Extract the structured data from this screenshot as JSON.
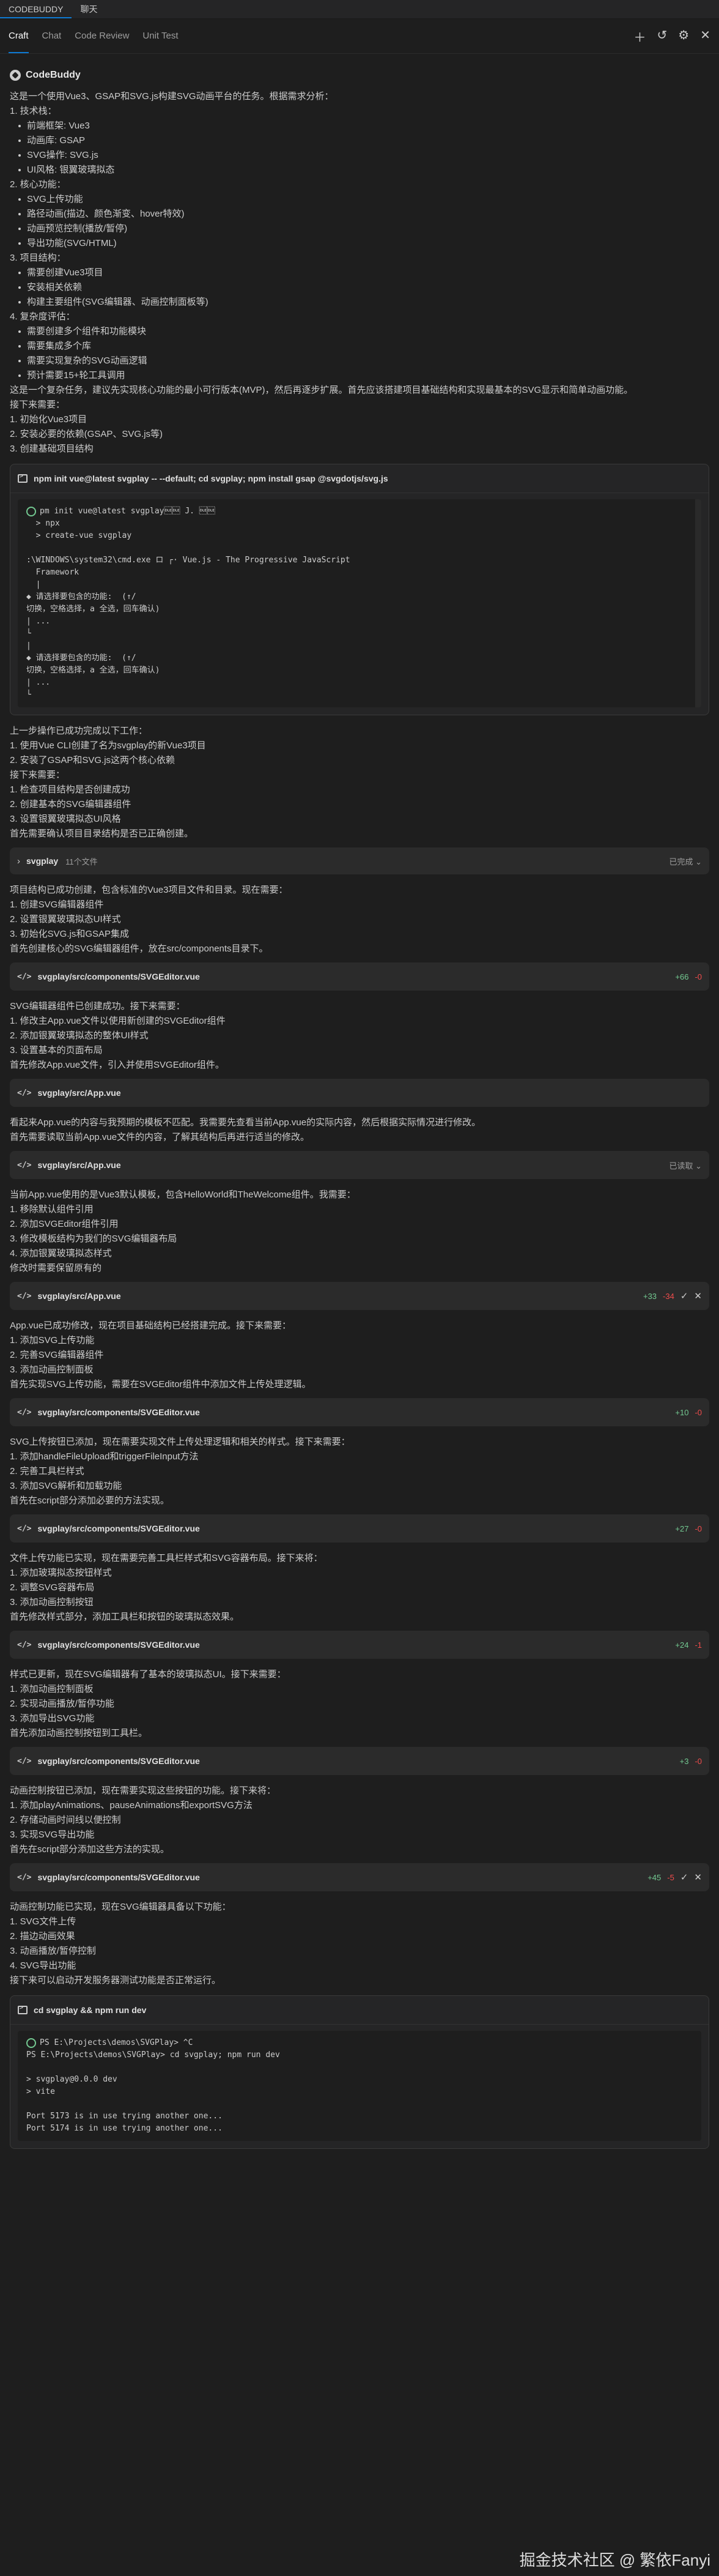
{
  "titlebar": {
    "tabs": [
      "CODEBUDDY",
      "聊天"
    ]
  },
  "tabs": [
    "Craft",
    "Chat",
    "Code Review",
    "Unit Test"
  ],
  "brand": "CodeBuddy",
  "sections": [
    {
      "kind": "text",
      "lines": [
        {
          "t": "这是一个使用Vue3、GSAP和SVG.js构建SVG动画平台的任务。根据需求分析：",
          "s": "p"
        },
        {
          "t": "1. 技术栈：",
          "s": "p"
        },
        {
          "t": "前端框架: Vue3",
          "s": "b"
        },
        {
          "t": "动画库: GSAP",
          "s": "b"
        },
        {
          "t": "SVG操作: SVG.js",
          "s": "b"
        },
        {
          "t": "UI风格: 银翼玻璃拟态",
          "s": "b"
        },
        {
          "t": "2. 核心功能：",
          "s": "p"
        },
        {
          "t": "SVG上传功能",
          "s": "b"
        },
        {
          "t": "路径动画(描边、颜色渐变、hover特效)",
          "s": "b"
        },
        {
          "t": "动画预览控制(播放/暂停)",
          "s": "b"
        },
        {
          "t": "导出功能(SVG/HTML)",
          "s": "b"
        },
        {
          "t": "3. 项目结构：",
          "s": "p"
        },
        {
          "t": "需要创建Vue3项目",
          "s": "b"
        },
        {
          "t": "安装相关依赖",
          "s": "b"
        },
        {
          "t": "构建主要组件(SVG编辑器、动画控制面板等)",
          "s": "b"
        },
        {
          "t": "4. 复杂度评估：",
          "s": "p"
        },
        {
          "t": "需要创建多个组件和功能模块",
          "s": "b"
        },
        {
          "t": "需要集成多个库",
          "s": "b"
        },
        {
          "t": "需要实现复杂的SVG动画逻辑",
          "s": "b"
        },
        {
          "t": "预计需要15+轮工具调用",
          "s": "b"
        },
        {
          "t": "这是一个复杂任务，建议先实现核心功能的最小可行版本(MVP)，然后再逐步扩展。首先应该搭建项目基础结构和实现最基本的SVG显示和简单动画功能。",
          "s": "p"
        },
        {
          "t": "接下来需要：",
          "s": "p"
        },
        {
          "t": "1. 初始化Vue3项目",
          "s": "p"
        },
        {
          "t": "2. 安装必要的依赖(GSAP、SVG.js等)",
          "s": "p"
        },
        {
          "t": "3. 创建基础项目结构",
          "s": "p"
        }
      ]
    },
    {
      "kind": "term",
      "title": "npm init vue@latest svgplay -- --default; cd svgplay; npm install gsap @svgdotjs/svg.js",
      "body": "pm init vue@latest svgplay\u0010\u0010 J. \u0010\u0010\n  > npx\n  > create-vue svgplay\n\n:\\WINDOWS\\system32\\cmd.exe ロ ┌· Vue.js - The Progressive JavaScript\n  Framework\n  |\n◆ 请选择要包含的功能:  (↑/\n切换，空格选择，a 全选，回车确认)\n| ...\n└\n|\n◆ 请选择要包含的功能:  (↑/\n切换，空格选择，a 全选，回车确认)\n| ...\n└",
      "scroll": true
    },
    {
      "kind": "text",
      "lines": [
        {
          "t": "上一步操作已成功完成以下工作：",
          "s": "p"
        },
        {
          "t": "1. 使用Vue CLI创建了名为svgplay的新Vue3项目",
          "s": "p"
        },
        {
          "t": "2. 安装了GSAP和SVG.js这两个核心依赖",
          "s": "p"
        },
        {
          "t": "接下来需要：",
          "s": "p"
        },
        {
          "t": "1. 检查项目结构是否创建成功",
          "s": "p"
        },
        {
          "t": "2. 创建基本的SVG编辑器组件",
          "s": "p"
        },
        {
          "t": "3. 设置银翼玻璃拟态UI风格",
          "s": "p"
        },
        {
          "t": "首先需要确认项目目录结构是否已正确创建。",
          "s": "p"
        }
      ]
    },
    {
      "kind": "folder",
      "name": "svgplay",
      "count": "11个文件",
      "status": "已完成 ⌄"
    },
    {
      "kind": "text",
      "lines": [
        {
          "t": "项目结构已成功创建，包含标准的Vue3项目文件和目录。现在需要：",
          "s": "p"
        },
        {
          "t": "1. 创建SVG编辑器组件",
          "s": "p"
        },
        {
          "t": "2. 设置银翼玻璃拟态UI样式",
          "s": "p"
        },
        {
          "t": "3. 初始化SVG.js和GSAP集成",
          "s": "p"
        },
        {
          "t": "首先创建核心的SVG编辑器组件，放在src/components目录下。",
          "s": "p"
        }
      ]
    },
    {
      "kind": "file",
      "path": "svgplay/src/components/SVGEditor.vue",
      "plus": "+66",
      "minus": "-0",
      "ok": false
    },
    {
      "kind": "text",
      "lines": [
        {
          "t": "SVG编辑器组件已创建成功。接下来需要：",
          "s": "p"
        },
        {
          "t": "1. 修改主App.vue文件以使用新创建的SVGEditor组件",
          "s": "p"
        },
        {
          "t": "2. 添加银翼玻璃拟态的整体UI样式",
          "s": "p"
        },
        {
          "t": "3. 设置基本的页面布局",
          "s": "p"
        },
        {
          "t": "首先修改App.vue文件，引入并使用SVGEditor组件。",
          "s": "p"
        }
      ]
    },
    {
      "kind": "file",
      "path": "svgplay/src/App.vue",
      "plus": "",
      "minus": "",
      "ok": false
    },
    {
      "kind": "text",
      "lines": [
        {
          "t": "看起来App.vue的内容与我预期的模板不匹配。我需要先查看当前App.vue的实际内容，然后根据实际情况进行修改。",
          "s": "p"
        },
        {
          "t": "首先需要读取当前App.vue文件的内容，了解其结构后再进行适当的修改。",
          "s": "p"
        }
      ]
    },
    {
      "kind": "file",
      "path": "svgplay/src/App.vue",
      "plus": "",
      "minus": "",
      "status": "已读取 ⌄",
      "ok": false
    },
    {
      "kind": "text",
      "lines": [
        {
          "t": "当前App.vue使用的是Vue3默认模板，包含HelloWorld和TheWelcome组件。我需要：",
          "s": "p"
        },
        {
          "t": "1. 移除默认组件引用",
          "s": "p"
        },
        {
          "t": "2. 添加SVGEditor组件引用",
          "s": "p"
        },
        {
          "t": "3. 修改模板结构为我们的SVG编辑器布局",
          "s": "p"
        },
        {
          "t": "4. 添加银翼玻璃拟态样式",
          "s": "p"
        },
        {
          "t": "修改时需要保留原有的",
          "s": "p"
        }
      ]
    },
    {
      "kind": "file",
      "path": "svgplay/src/App.vue",
      "plus": "+33",
      "minus": "-34",
      "ok": true
    },
    {
      "kind": "text",
      "lines": [
        {
          "t": "App.vue已成功修改，现在项目基础结构已经搭建完成。接下来需要：",
          "s": "p"
        },
        {
          "t": "1. 添加SVG上传功能",
          "s": "p"
        },
        {
          "t": "2. 完善SVG编辑器组件",
          "s": "p"
        },
        {
          "t": "3. 添加动画控制面板",
          "s": "p"
        },
        {
          "t": "首先实现SVG上传功能，需要在SVGEditor组件中添加文件上传处理逻辑。",
          "s": "p"
        }
      ]
    },
    {
      "kind": "file",
      "path": "svgplay/src/components/SVGEditor.vue",
      "plus": "+10",
      "minus": "-0",
      "ok": false
    },
    {
      "kind": "text",
      "lines": [
        {
          "t": "SVG上传按钮已添加，现在需要实现文件上传处理逻辑和相关的样式。接下来需要：",
          "s": "p"
        },
        {
          "t": "1. 添加handleFileUpload和triggerFileInput方法",
          "s": "p"
        },
        {
          "t": "2. 完善工具栏样式",
          "s": "p"
        },
        {
          "t": "3. 添加SVG解析和加载功能",
          "s": "p"
        },
        {
          "t": "首先在script部分添加必要的方法实现。",
          "s": "p"
        }
      ]
    },
    {
      "kind": "file",
      "path": "svgplay/src/components/SVGEditor.vue",
      "plus": "+27",
      "minus": "-0",
      "ok": false
    },
    {
      "kind": "text",
      "lines": [
        {
          "t": "文件上传功能已实现，现在需要完善工具栏样式和SVG容器布局。接下来将：",
          "s": "p"
        },
        {
          "t": "1. 添加玻璃拟态按钮样式",
          "s": "p"
        },
        {
          "t": "2. 调整SVG容器布局",
          "s": "p"
        },
        {
          "t": "3. 添加动画控制按钮",
          "s": "p"
        },
        {
          "t": "首先修改样式部分，添加工具栏和按钮的玻璃拟态效果。",
          "s": "p"
        }
      ]
    },
    {
      "kind": "file",
      "path": "svgplay/src/components/SVGEditor.vue",
      "plus": "+24",
      "minus": "-1",
      "ok": false
    },
    {
      "kind": "text",
      "lines": [
        {
          "t": "样式已更新，现在SVG编辑器有了基本的玻璃拟态UI。接下来需要：",
          "s": "p"
        },
        {
          "t": "1. 添加动画控制面板",
          "s": "p"
        },
        {
          "t": "2. 实现动画播放/暂停功能",
          "s": "p"
        },
        {
          "t": "3. 添加导出SVG功能",
          "s": "p"
        },
        {
          "t": "首先添加动画控制按钮到工具栏。",
          "s": "p"
        }
      ]
    },
    {
      "kind": "file",
      "path": "svgplay/src/components/SVGEditor.vue",
      "plus": "+3",
      "minus": "-0",
      "ok": false
    },
    {
      "kind": "text",
      "lines": [
        {
          "t": "动画控制按钮已添加，现在需要实现这些按钮的功能。接下来将：",
          "s": "p"
        },
        {
          "t": "1. 添加playAnimations、pauseAnimations和exportSVG方法",
          "s": "p"
        },
        {
          "t": "2. 存储动画时间线以便控制",
          "s": "p"
        },
        {
          "t": "3. 实现SVG导出功能",
          "s": "p"
        },
        {
          "t": "首先在script部分添加这些方法的实现。",
          "s": "p"
        }
      ]
    },
    {
      "kind": "file",
      "path": "svgplay/src/components/SVGEditor.vue",
      "plus": "+45",
      "minus": "-5",
      "ok": true
    },
    {
      "kind": "text",
      "lines": [
        {
          "t": "动画控制功能已实现，现在SVG编辑器具备以下功能：",
          "s": "p"
        },
        {
          "t": "1. SVG文件上传",
          "s": "p"
        },
        {
          "t": "2. 描边动画效果",
          "s": "p"
        },
        {
          "t": "3. 动画播放/暂停控制",
          "s": "p"
        },
        {
          "t": "4. SVG导出功能",
          "s": "p"
        },
        {
          "t": "接下来可以启动开发服务器测试功能是否正常运行。",
          "s": "p"
        }
      ]
    },
    {
      "kind": "term",
      "title": "cd svgplay && npm run dev",
      "body": "PS E:\\Projects\\demos\\SVGPlay> ^C\nPS E:\\Projects\\demos\\SVGPlay> cd svgplay; npm run dev\n\n> svgplay@0.0.0 dev\n> vite\n\nPort 5173 is in use trying another one...\nPort 5174 is in use trying another one...",
      "scroll": false
    }
  ],
  "watermark": "掘金技术社区 @ 繁依Fanyi",
  "colors": {
    "bg": "#1e1e1e",
    "accent": "#0e7ad3",
    "added": "#73c991",
    "removed": "#f14c4c"
  }
}
